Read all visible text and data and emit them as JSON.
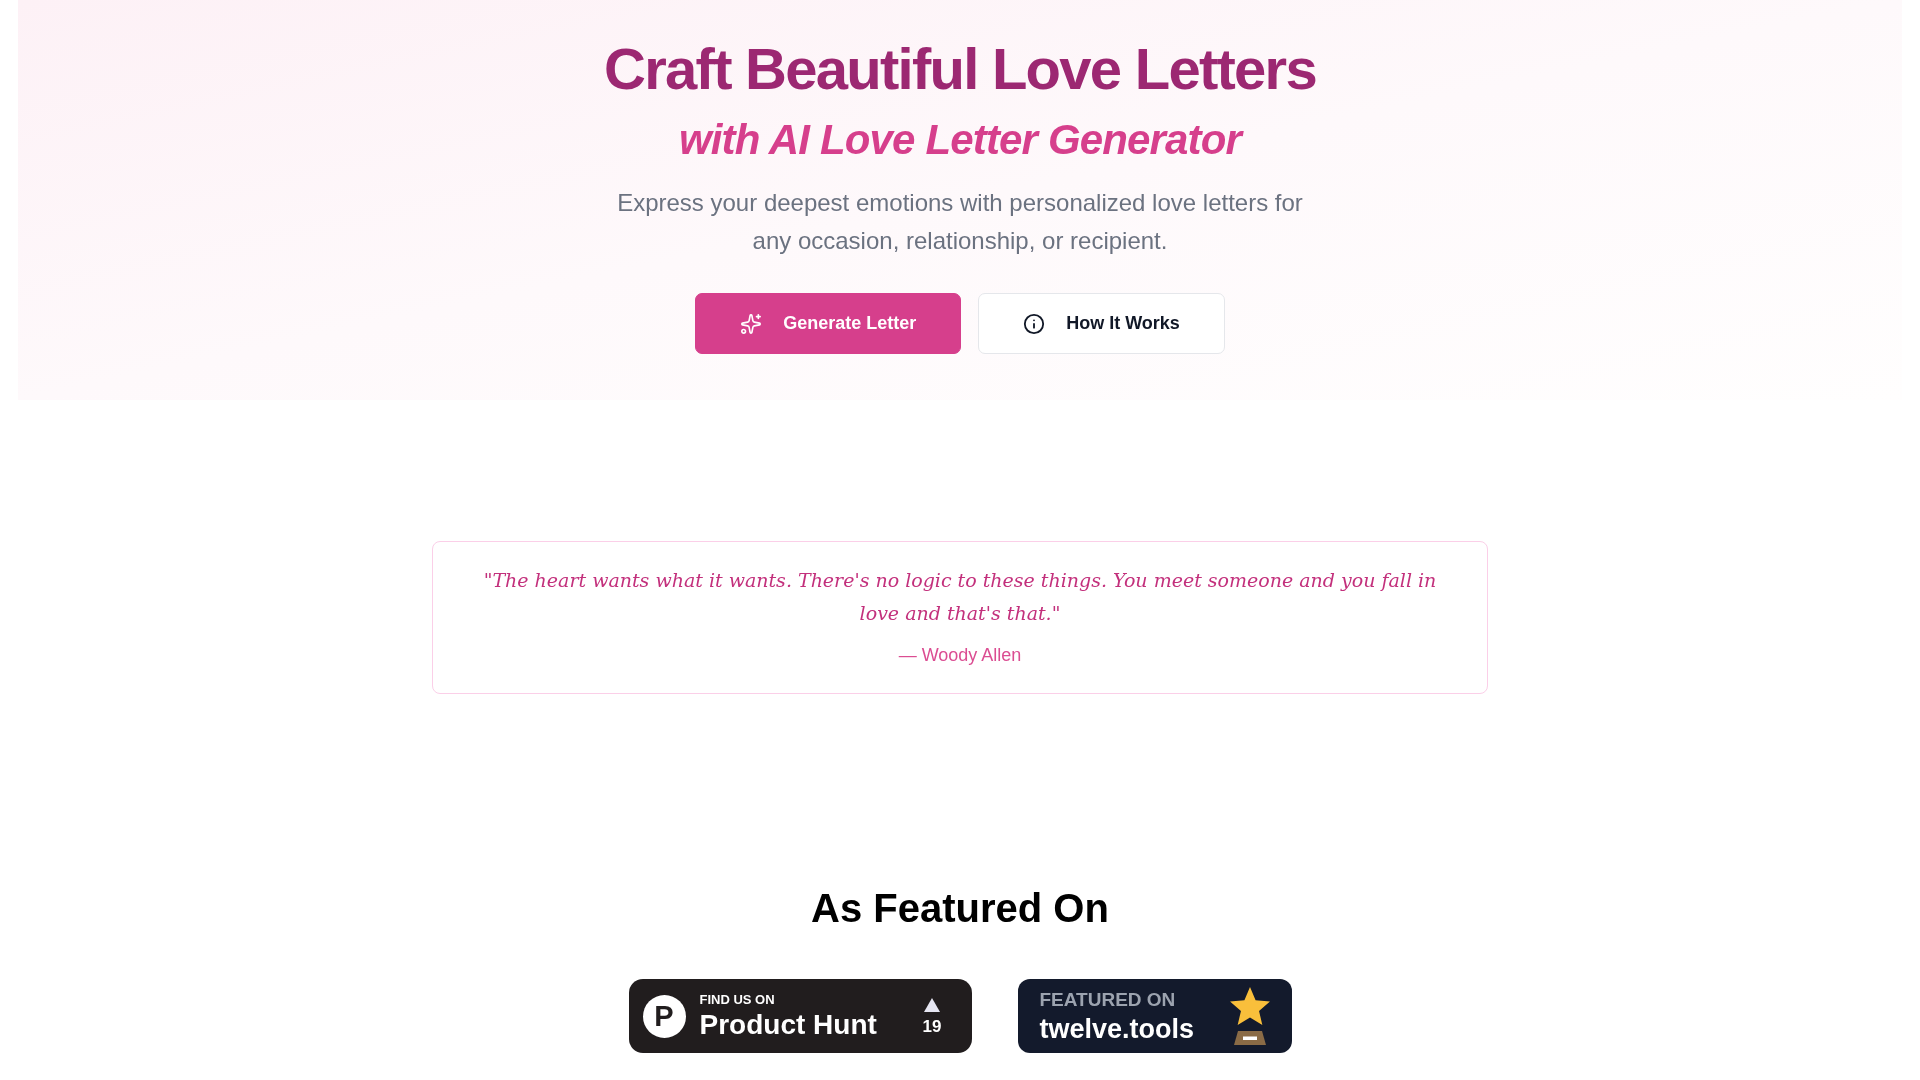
{
  "hero": {
    "title": "Craft Beautiful Love Letters",
    "subtitle": "with AI Love Letter Generator",
    "description": "Express your deepest emotions with personalized love letters for any occasion, relationship, or recipient.",
    "buttons": [
      {
        "label": "Generate Letter",
        "kind": "primary"
      },
      {
        "label": "How It Works",
        "kind": "secondary"
      }
    ]
  },
  "quote": {
    "text": "\"The heart wants what it wants. There's no logic to these things. You meet someone and you fall in love and that's that.\"",
    "author": "— Woody Allen"
  },
  "featured": {
    "heading": "As Featured On",
    "badges": [
      {
        "kind": "producthunt",
        "logo": "P",
        "caption": "FIND US ON",
        "name": "Product Hunt",
        "votes": "19"
      },
      {
        "kind": "twelvetools",
        "caption": "FEATURED ON",
        "name": "twelve.tools"
      }
    ]
  }
}
